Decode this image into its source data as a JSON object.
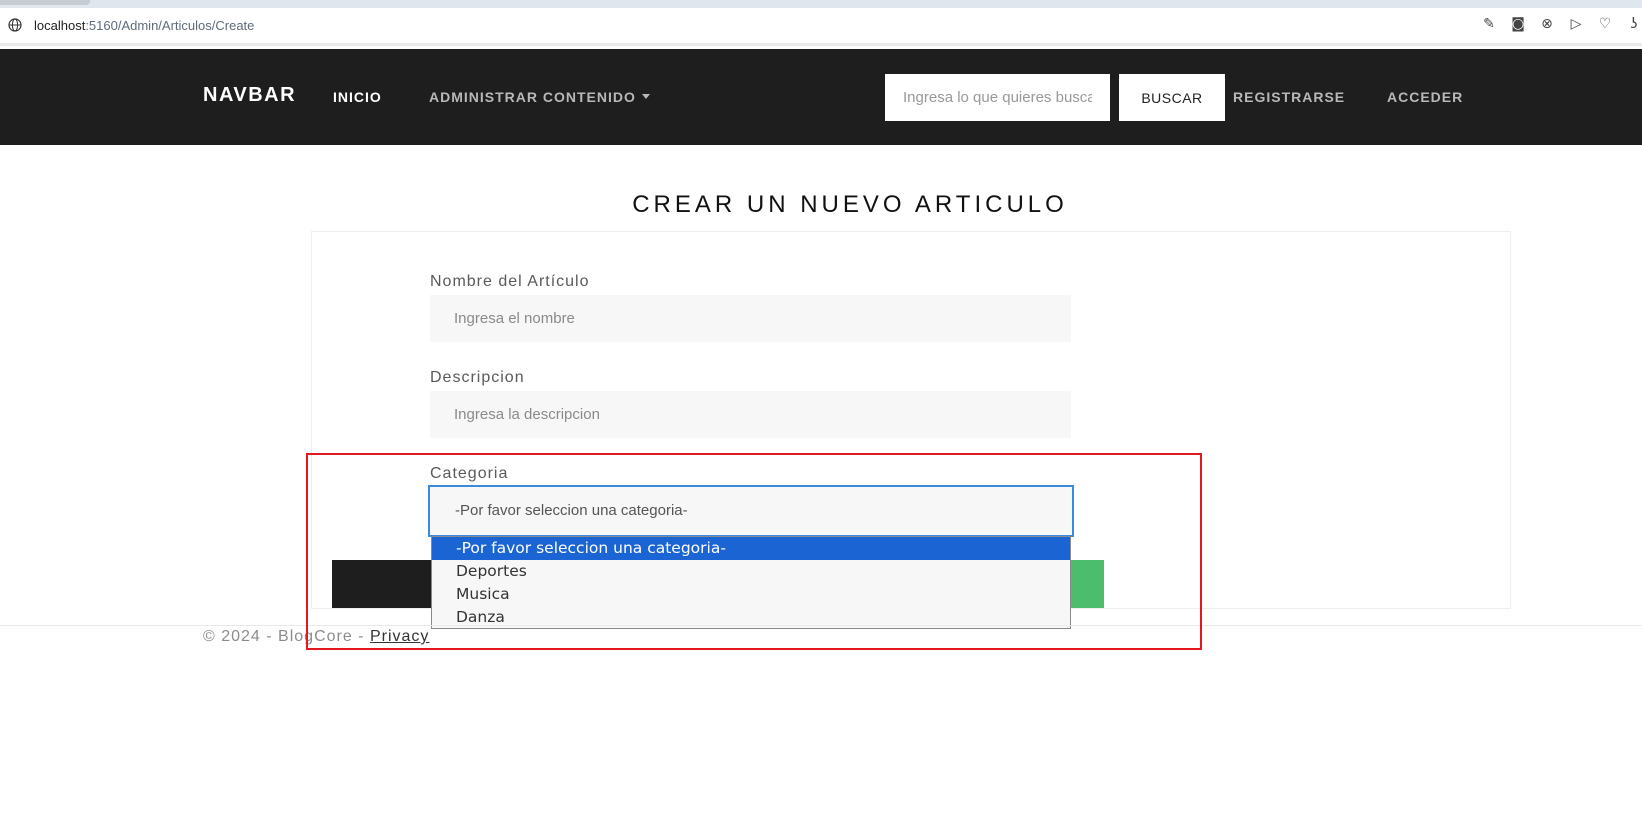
{
  "browser": {
    "url_host": "localhost",
    "url_path": ":5160/Admin/Articulos/Create",
    "icons": [
      "edit-icon",
      "camera-icon",
      "shield-icon",
      "play-icon",
      "heart-icon",
      "extension-icon"
    ]
  },
  "navbar": {
    "brand": "NAVBAR",
    "inicio": "INICIO",
    "admin": "ADMINISTRAR CONTENIDO",
    "search_placeholder": "Ingresa lo que quieres buscar",
    "search_button": "BUSCAR",
    "register": "REGISTRARSE",
    "login": "ACCEDER"
  },
  "form": {
    "title": "CREAR UN NUEVO ARTICULO",
    "nombre_label": "Nombre del Artículo",
    "nombre_placeholder": "Ingresa el nombre",
    "descripcion_label": "Descripcion",
    "descripcion_placeholder": "Ingresa la descripcion",
    "categoria_label": "Categoria",
    "categoria_selected": "-Por favor seleccion una categoria-",
    "categoria_options": [
      "-Por favor seleccion una categoria-",
      "Deportes",
      "Musica",
      "Danza"
    ]
  },
  "footer": {
    "text": "© 2024 - BlogCore - ",
    "privacy": "Privacy"
  },
  "colors": {
    "navbar_bg": "#1e1e1e",
    "focus_border": "#3a8be0",
    "selected_option": "#1b64d3",
    "highlight_box": "#e4171e",
    "submit_green": "#4bbd6d"
  }
}
